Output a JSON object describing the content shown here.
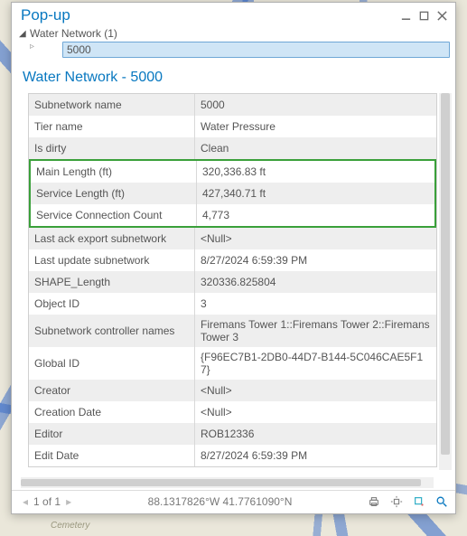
{
  "popup": {
    "title": "Pop-up",
    "tree": {
      "root_label": "Water Network (1)",
      "selected_label": "5000"
    },
    "feature_title": "Water Network - 5000"
  },
  "attributes": {
    "rows": [
      {
        "key": "Subnetwork name",
        "value": "5000",
        "hl": false
      },
      {
        "key": "Tier name",
        "value": "Water Pressure",
        "hl": false
      },
      {
        "key": "Is dirty",
        "value": "Clean",
        "hl": false
      },
      {
        "key": "Main Length (ft)",
        "value": "320,336.83 ft",
        "hl": true
      },
      {
        "key": "Service Length (ft)",
        "value": "427,340.71 ft",
        "hl": true
      },
      {
        "key": "Service Connection Count",
        "value": "4,773",
        "hl": true
      },
      {
        "key": "Last ack export subnetwork",
        "value": "<Null>",
        "hl": false
      },
      {
        "key": "Last update subnetwork",
        "value": "8/27/2024 6:59:39 PM",
        "hl": false
      },
      {
        "key": "SHAPE_Length",
        "value": "320336.825804",
        "hl": false
      },
      {
        "key": "Object ID",
        "value": "3",
        "hl": false
      },
      {
        "key": "Subnetwork controller names",
        "value": "Firemans Tower 1::Firemans Tower 2::Firemans Tower 3",
        "hl": false
      },
      {
        "key": "Global ID",
        "value": "{F96EC7B1-2DB0-44D7-B144-5C046CAE5F17}",
        "hl": false
      },
      {
        "key": "Creator",
        "value": "<Null>",
        "hl": false
      },
      {
        "key": "Creation Date",
        "value": "<Null>",
        "hl": false
      },
      {
        "key": "Editor",
        "value": "ROB12336",
        "hl": false
      },
      {
        "key": "Edit Date",
        "value": "8/27/2024 6:59:39 PM",
        "hl": false
      }
    ]
  },
  "statusbar": {
    "pager_text": "1 of 1",
    "coords": "88.1317826°W 41.7761090°N"
  },
  "map_labels": {
    "cemetery": "Cemetery"
  }
}
